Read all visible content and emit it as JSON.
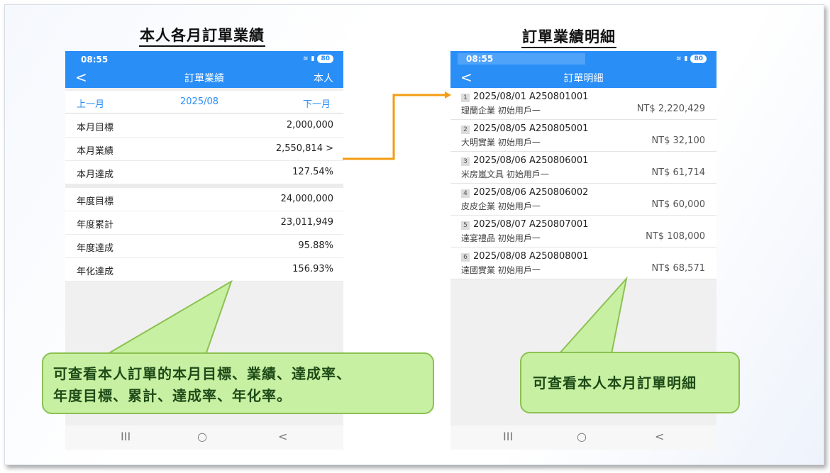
{
  "headings": {
    "left": "本人各月訂單業績",
    "right": "訂單業績明細"
  },
  "left_phone": {
    "time": "08:55",
    "battery": "80",
    "nav": {
      "back": "<",
      "title": "訂單業績",
      "right": "本人"
    },
    "month_bar": {
      "prev": "上一月",
      "current": "2025/08",
      "next": "下一月"
    },
    "rows": [
      {
        "label": "本月目標",
        "value": "2,000,000"
      },
      {
        "label": "本月業績",
        "value": "2,550,814 >"
      },
      {
        "label": "本月達成",
        "value": "127.54%"
      },
      {
        "label": "年度目標",
        "value": "24,000,000"
      },
      {
        "label": "年度累計",
        "value": "23,011,949"
      },
      {
        "label": "年度達成",
        "value": "95.88%"
      },
      {
        "label": "年化達成",
        "value": "156.93%"
      }
    ],
    "bottom_nav": {
      "recent": "III",
      "home": "○",
      "back": "<"
    }
  },
  "right_phone": {
    "time": "08:55",
    "battery": "80",
    "nav": {
      "back": "<",
      "title": "訂單明細"
    },
    "orders": [
      {
        "index": "1",
        "header": "2025/08/01 A250801001",
        "customer": "理蘭企業 初始用戶一",
        "amount": "NT$ 2,220,429"
      },
      {
        "index": "2",
        "header": "2025/08/05 A250805001",
        "customer": "大明實業 初始用戶一",
        "amount": "NT$ 32,100"
      },
      {
        "index": "3",
        "header": "2025/08/06 A250806001",
        "customer": "米房嵐文具 初始用戶一",
        "amount": "NT$ 61,714"
      },
      {
        "index": "4",
        "header": "2025/08/06 A250806002",
        "customer": "皮皮企業 初始用戶一",
        "amount": "NT$ 60,000"
      },
      {
        "index": "5",
        "header": "2025/08/07 A250807001",
        "customer": "達宴禮品 初始用戶一",
        "amount": "NT$ 108,000"
      },
      {
        "index": "6",
        "header": "2025/08/08 A250808001",
        "customer": "達國實業 初始用戶一",
        "amount": "NT$ 68,571"
      }
    ],
    "bottom_nav": {
      "recent": "III",
      "home": "○",
      "back": "<"
    }
  },
  "callouts": {
    "left_line1": "可查看本人訂單的本月目標、業績、達成率、",
    "left_line2": "年度目標、累計、達成率、年化率。",
    "right": "可查看本人本月訂單明細"
  },
  "colors": {
    "accent": "#2a8ef7",
    "callout_fill": "#c8f0a2",
    "callout_border": "#8cc152",
    "arrow": "#f39c12"
  }
}
